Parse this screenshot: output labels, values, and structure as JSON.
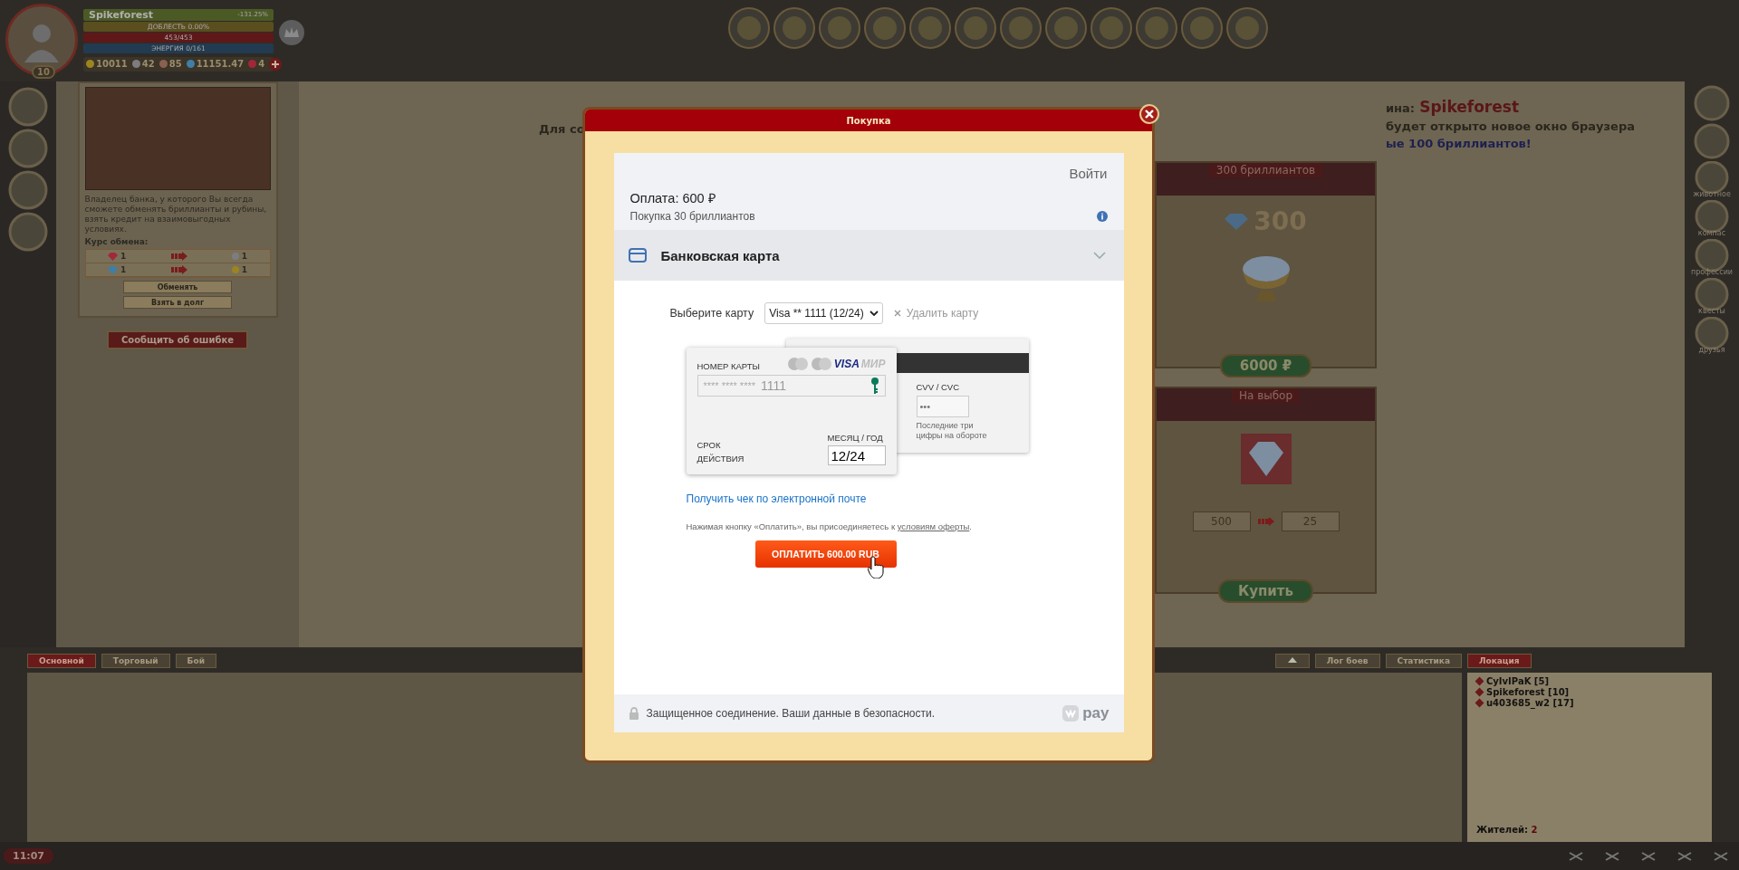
{
  "hud": {
    "name": "Spikeforest",
    "percent": "-131.25%",
    "valor": "ДОБЛЕСТЬ 0.00%",
    "health": "453/453",
    "energy": "ЭНЕРГИЯ 0/161",
    "level": "10",
    "currencies": [
      {
        "kind": "gold",
        "value": "10011"
      },
      {
        "kind": "silver",
        "value": "42"
      },
      {
        "kind": "copper",
        "value": "85"
      },
      {
        "kind": "diamond",
        "value": "11151.47"
      },
      {
        "kind": "ruby",
        "value": "4"
      }
    ]
  },
  "banker": {
    "description": "Владелец банка, у которого Вы всегда сможете обменять бриллианты и рубины, взять кредит на взаимовыгодных условиях.",
    "rate_title": "Курс обмена:",
    "rates": [
      {
        "from": {
          "kind": "ruby",
          "amount": "1"
        },
        "to": {
          "kind": "silver",
          "amount": "1"
        }
      },
      {
        "from": {
          "kind": "diamond",
          "amount": "1"
        },
        "to": {
          "kind": "gold",
          "amount": "1"
        }
      }
    ],
    "buttons": [
      "Обменять",
      "Взять в долг"
    ],
    "report": "Сообщить об ошибке"
  },
  "shop_header": {
    "left_fragment": "Для со",
    "title_fragment": "ина:",
    "player": "Spikeforest",
    "line2_fragment": "будет открыто новое окно браузера",
    "line3_fragment": "ые 100 бриллиантов!"
  },
  "offers": [
    {
      "kind": "fixed",
      "title": "300 бриллиантов",
      "amount": "300",
      "button": "6000 ₽"
    },
    {
      "kind": "choice",
      "title": "На выбор",
      "from_value": "500",
      "to_value": "25",
      "button": "Купить"
    }
  ],
  "right_rail": [
    "животное",
    "компас",
    "профессии",
    "квесты",
    "друзья"
  ],
  "chat": {
    "tabs": [
      {
        "label": "Основной",
        "selected": true
      },
      {
        "label": "Торговый",
        "selected": false
      },
      {
        "label": "Бой",
        "selected": false
      }
    ],
    "log_tabs": [
      "Лог боев",
      "Статистика"
    ],
    "location_tab": {
      "label": "Локация",
      "selected": true
    },
    "players": [
      {
        "name": "CyIvIPaK",
        "level": "[5]"
      },
      {
        "name": "Spikeforest",
        "level": "[10]"
      },
      {
        "name": "u403685_w2",
        "level": "[17]"
      }
    ],
    "residents_label": "Жителей:",
    "residents": "2"
  },
  "clock": "11:07",
  "modal": {
    "title": "Покупка",
    "login": "Войти",
    "amount": "Оплата: 600 ₽",
    "subtitle": "Покупка 30 бриллиантов",
    "method": "Банковская карта",
    "select_label": "Выберите карту",
    "select_value": "Visa ** 1111 (12/24)",
    "delete": "Удалить карту",
    "number_label": "НОМЕР КАРТЫ",
    "brands": [
      "VISA",
      "МИР"
    ],
    "number_mask": "**** **** ****",
    "number_last": "1111",
    "expiry_label": "СРОК ДЕЙСТВИЯ",
    "month_label": "МЕСЯЦ / ГОД",
    "expiry": "12/24",
    "cvv_label": "CVV / CVC",
    "cvv_placeholder": "•••",
    "cvv_hint": "Последние три цифры на обороте",
    "receipt_link": "Получить чек по электронной почте",
    "terms": "Нажимая кнопку «Оплатить», вы присоединяетесь к",
    "terms_link": "условиям оферты",
    "terms_end": ".",
    "pay_button": "ОПЛАТИТЬ 600.00 RUB",
    "secure": "Защищенное соединение. Ваши данные в безопасности.",
    "brand": "pay"
  }
}
